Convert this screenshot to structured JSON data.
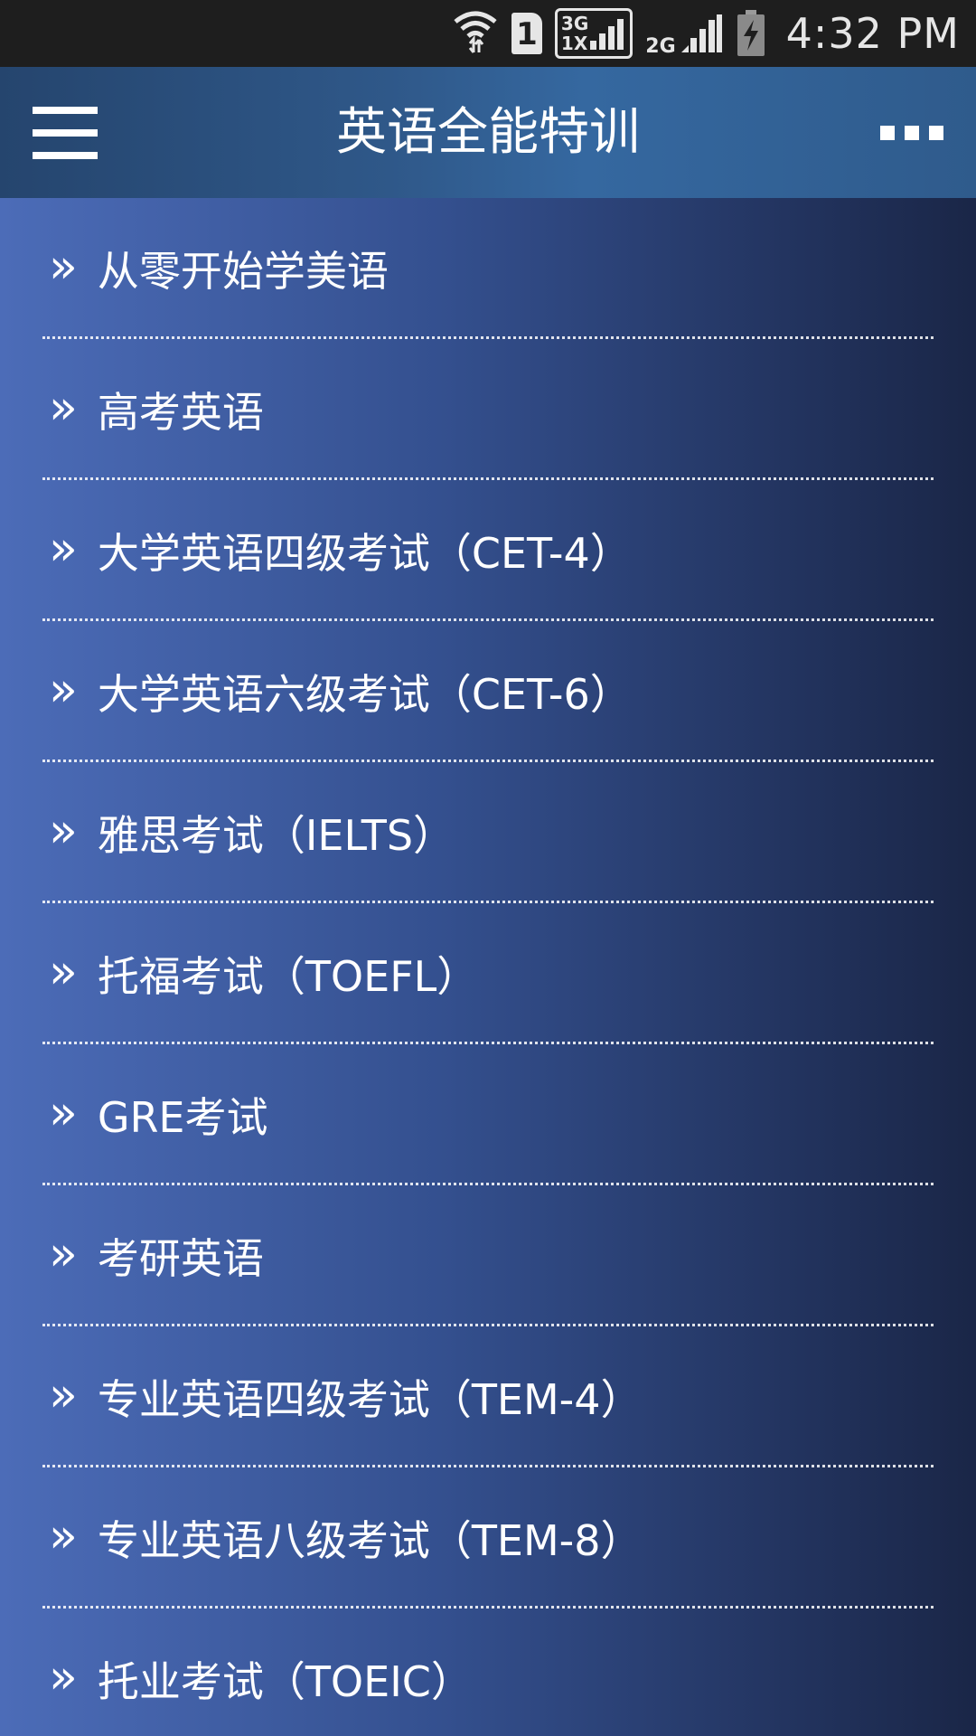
{
  "status_bar": {
    "time": "4:32 PM",
    "sim_slot": "1",
    "net_top": "3G",
    "net_bottom": "1X",
    "net_2g": "2G",
    "icons": [
      "wifi-icon",
      "sim-card-icon",
      "signal-3g-1x-icon",
      "signal-2g-icon",
      "battery-charging-icon"
    ]
  },
  "app_bar": {
    "title": "英语全能特训",
    "menu_icon": "hamburger-menu-icon",
    "overflow_icon": "more-options-icon"
  },
  "list": {
    "bullet": "»",
    "items": [
      "从零开始学美语",
      "高考英语",
      "大学英语四级考试（CET-4）",
      "大学英语六级考试（CET-6）",
      "雅思考试（IELTS）",
      "托福考试（TOEFL）",
      "GRE考试",
      "考研英语",
      "专业英语四级考试（TEM-4）",
      "专业英语八级考试（TEM-8）",
      "托业考试（TOEIC）"
    ]
  },
  "colors": {
    "status_bar_bg": "#1e1e1e",
    "app_bar": "#3568a0",
    "background_left": "#4c6cb8",
    "background_right": "#1a2647",
    "text": "#ffffff"
  }
}
